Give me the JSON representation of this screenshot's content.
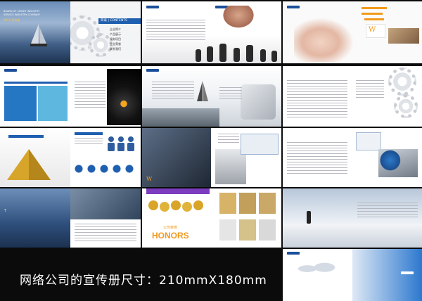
{
  "caption": "网络公司的宣传册尺寸：210mmX180mm",
  "cover": {
    "title_lines": [
      "BOARD OF CREDIT INDUSTRY",
      "SERVICE INDUSTRY COMPANY"
    ],
    "subtitle": "2013 宣传册"
  },
  "contents": {
    "title": "目录 | CONTENTS",
    "items": [
      "企业简介",
      "产品展示",
      "服务项目",
      "企业荣誉",
      "联系我们"
    ]
  },
  "honors": {
    "label": "公司荣誉",
    "title": "HONORS"
  },
  "colors": {
    "brand_blue": "#1f5fb0",
    "accent_orange": "#f29a1d",
    "background": "#0b0b0b"
  }
}
